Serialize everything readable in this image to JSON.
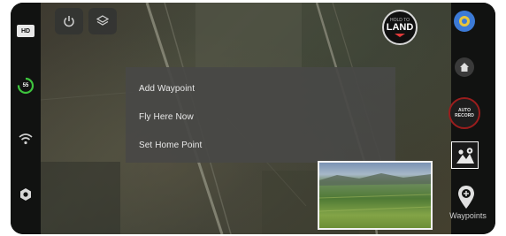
{
  "context_menu": {
    "items": [
      {
        "label": "Add Waypoint"
      },
      {
        "label": "Fly Here Now"
      },
      {
        "label": "Set Home Point"
      }
    ]
  },
  "left_sidebar": {
    "hd_label": "HD",
    "battery_label": "55",
    "icons": [
      "hd-icon",
      "battery-icon",
      "wifi-icon",
      "settings-icon"
    ]
  },
  "top_toolbar": {
    "icons": [
      "power-icon",
      "layers-icon"
    ]
  },
  "land_button": {
    "top_label": "HOLD TO",
    "main_label": "LAND"
  },
  "right_sidebar": {
    "icons": [
      "compass-icon",
      "home-icon",
      "auto-record-icon",
      "waypoint-mode-icon",
      "waypoints-icon"
    ],
    "auto_record_label_1": "AUTO",
    "auto_record_label_2": "RECORD",
    "waypoints_label": "Waypoints"
  },
  "colors": {
    "menu_background": "#484846",
    "battery_green": "#3ec43e",
    "record_red": "#9a1d1d",
    "land_arrow_red": "#e23a3a",
    "compass_blue": "#3c7ad6"
  }
}
